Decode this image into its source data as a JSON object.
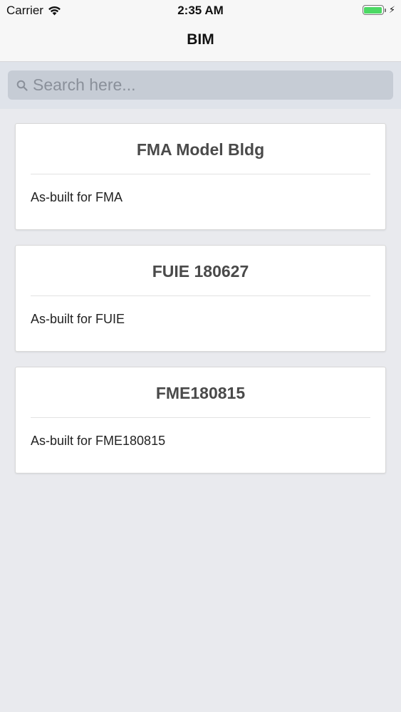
{
  "status_bar": {
    "carrier": "Carrier",
    "time": "2:35 AM",
    "battery_level": 1.0,
    "battery_color": "#4cd964",
    "charging_icon": "bolt-icon"
  },
  "nav": {
    "title": "BIM"
  },
  "search": {
    "placeholder": "Search here...",
    "value": "",
    "icon": "search-icon"
  },
  "projects": [
    {
      "title": "FMA Model Bldg",
      "description": "As-built for FMA"
    },
    {
      "title": "FUIE 180627",
      "description": "As-built for FUIE"
    },
    {
      "title": "FME180815",
      "description": "As-built for FME180815"
    }
  ],
  "colors": {
    "background": "#e9eaee",
    "card": "#ffffff",
    "card_title": "#4a4a4a"
  }
}
